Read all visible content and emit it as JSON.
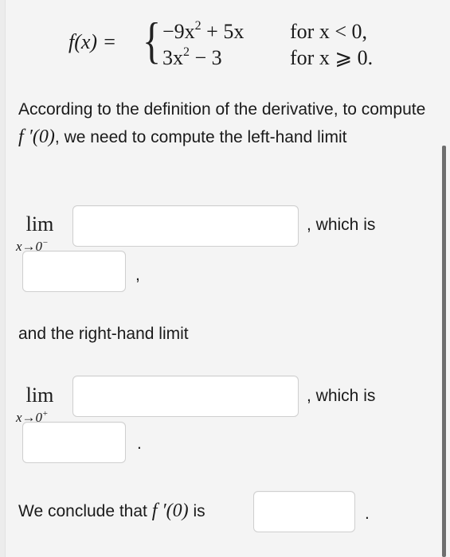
{
  "piecewise": {
    "lhs": "f(x) =",
    "brace": "{",
    "case1_expr_a": "−9x",
    "case1_exp": "2",
    "case1_expr_b": " + 5x",
    "case1_cond": "for x < 0,",
    "case2_expr_a": "3x",
    "case2_exp": "2",
    "case2_expr_b": " − 3",
    "case2_cond": "for x ⩾ 0."
  },
  "intro": {
    "text_a": "According to the definition of the derivative, to compute ",
    "fprime0": "f ′(0)",
    "text_b": ", we need to compute the left-hand limit"
  },
  "left_limit": {
    "lim": "lim",
    "sub_var": "x→0",
    "sub_sup": "−",
    "expr_value": "",
    "which_is": ", which is",
    "result_value": "",
    "trailing": ","
  },
  "right_intro": "and the right-hand limit",
  "right_limit": {
    "lim": "lim",
    "sub_var": "x→0",
    "sub_sup": "+",
    "expr_value": "",
    "which_is": ", which is",
    "result_value": "",
    "trailing": "."
  },
  "conclusion": {
    "text": "We conclude that ",
    "fprime0": "f ′(0)",
    "is": " is",
    "answer_value": "",
    "trailing": "."
  }
}
